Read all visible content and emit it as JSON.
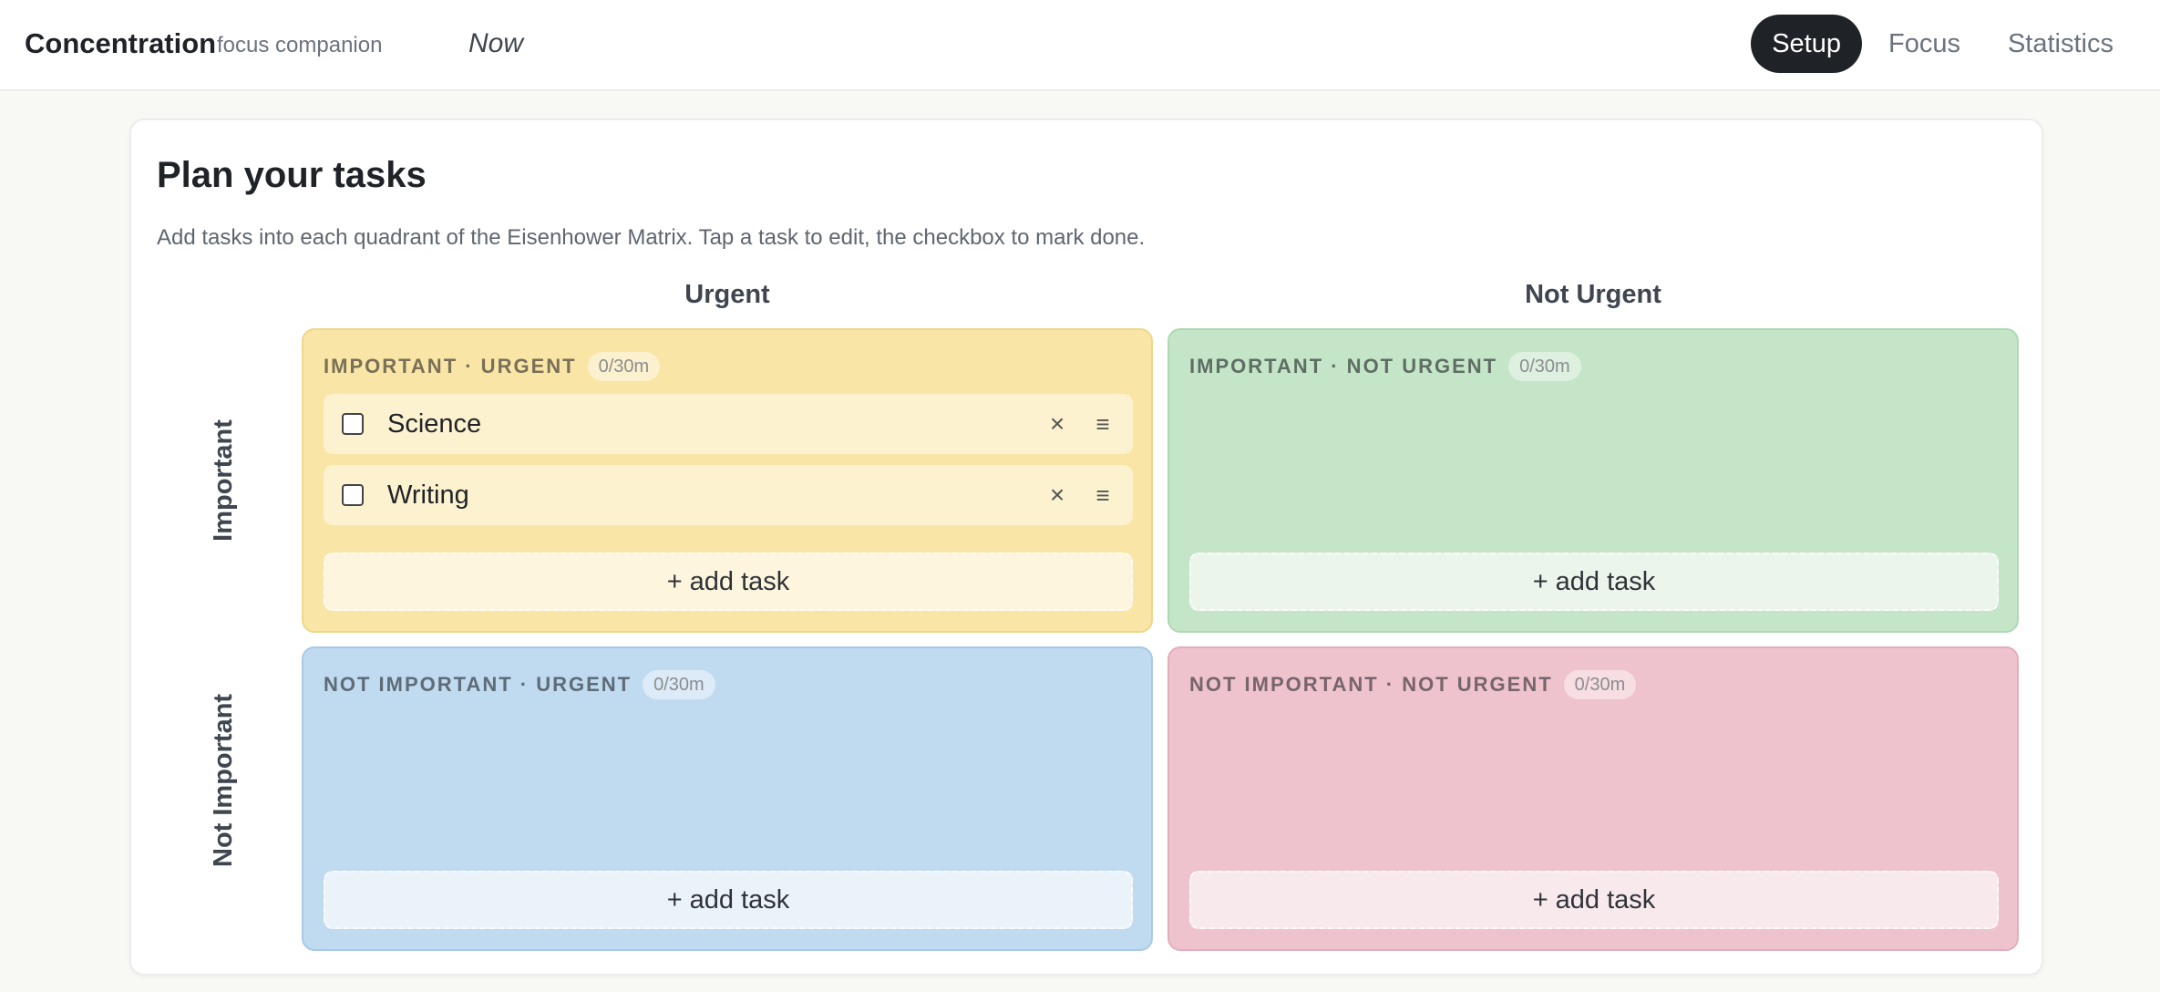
{
  "header": {
    "brand": "Concentration",
    "tagline": "focus companion",
    "now": "Now",
    "nav": [
      {
        "label": "Setup",
        "active": true
      },
      {
        "label": "Focus",
        "active": false
      },
      {
        "label": "Statistics",
        "active": false
      }
    ]
  },
  "plan": {
    "title": "Plan your tasks",
    "description": "Add tasks into each quadrant of the Eisenhower Matrix. Tap a task to edit, the checkbox to mark done.",
    "columns": [
      "Urgent",
      "Not Urgent"
    ],
    "rows": [
      "Important",
      "Not Important"
    ],
    "quadrants": [
      {
        "title": "IMPORTANT · URGENT",
        "badge": "0/30m",
        "color": "#f9e6a6",
        "tasks": [
          {
            "label": "Science",
            "done": false
          },
          {
            "label": "Writing",
            "done": false
          }
        ],
        "add_label": "+ add task"
      },
      {
        "title": "IMPORTANT · NOT URGENT",
        "badge": "0/30m",
        "color": "#c4e5c8",
        "tasks": [],
        "add_label": "+ add task"
      },
      {
        "title": "NOT IMPORTANT · URGENT",
        "badge": "0/30m",
        "color": "#c0daf0",
        "tasks": [],
        "add_label": "+ add task"
      },
      {
        "title": "NOT IMPORTANT · NOT URGENT",
        "badge": "0/30m",
        "color": "#eec3cd",
        "tasks": [],
        "add_label": "+ add task"
      }
    ],
    "icons": {
      "remove": "close-icon",
      "drag": "drag-handle-icon"
    }
  }
}
